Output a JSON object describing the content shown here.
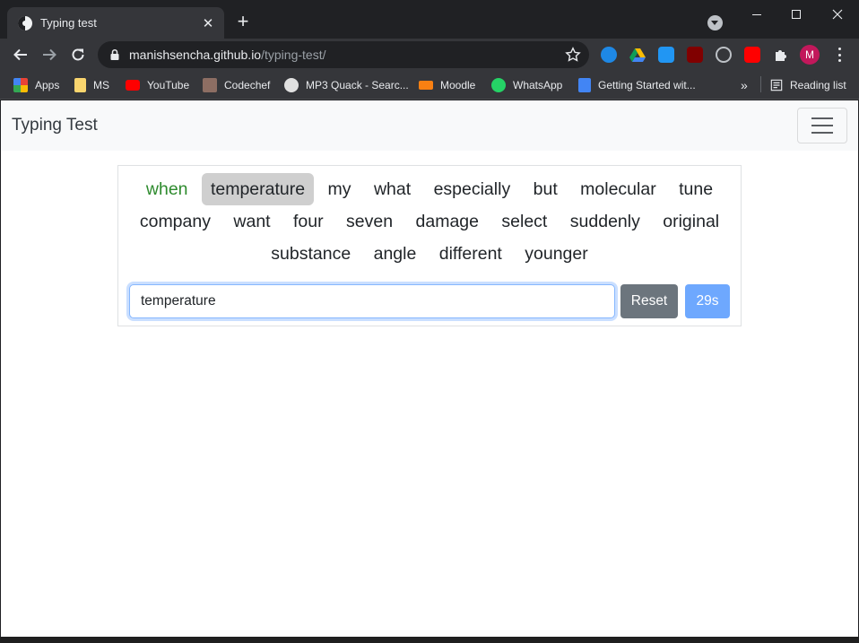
{
  "browser": {
    "tab_title": "Typing test",
    "tab_close": "✕",
    "new_tab": "+",
    "url_host": "manishsencha.github.io",
    "url_path": "/typing-test/",
    "profile_initial": "M"
  },
  "bookmarks": [
    {
      "label": "Apps",
      "icon": "apps-grid-icon",
      "color": "#ea4335"
    },
    {
      "label": "MS",
      "icon": "folder-icon",
      "color": "#f9d56e"
    },
    {
      "label": "YouTube",
      "icon": "youtube-icon",
      "color": "#ff0000"
    },
    {
      "label": "Codechef",
      "icon": "codechef-icon",
      "color": "#8d6e63"
    },
    {
      "label": "MP3 Quack - Searc...",
      "icon": "mp3quack-icon",
      "color": "#e0e0e0"
    },
    {
      "label": "Moodle",
      "icon": "moodle-icon",
      "color": "#f98012"
    },
    {
      "label": "WhatsApp",
      "icon": "whatsapp-icon",
      "color": "#25d366"
    },
    {
      "label": "Getting Started wit...",
      "icon": "docs-icon",
      "color": "#4285f4"
    }
  ],
  "bookmarks_overflow": "»",
  "reading_list": "Reading list",
  "app": {
    "brand": "Typing Test",
    "words": [
      "when",
      "temperature",
      "my",
      "what",
      "especially",
      "but",
      "molecular",
      "tune",
      "company",
      "want",
      "four",
      "seven",
      "damage",
      "select",
      "suddenly",
      "original",
      "substance",
      "angle",
      "different",
      "younger"
    ],
    "completed_count": 1,
    "current_index": 1,
    "input_value": "temperature",
    "reset_label": "Reset",
    "timer_label": "29s",
    "colors": {
      "correct": "#2e8b2e",
      "current_bg": "#cfcfcf",
      "reset_bg": "#6c757d",
      "timer_bg": "#6ea8fe"
    }
  }
}
